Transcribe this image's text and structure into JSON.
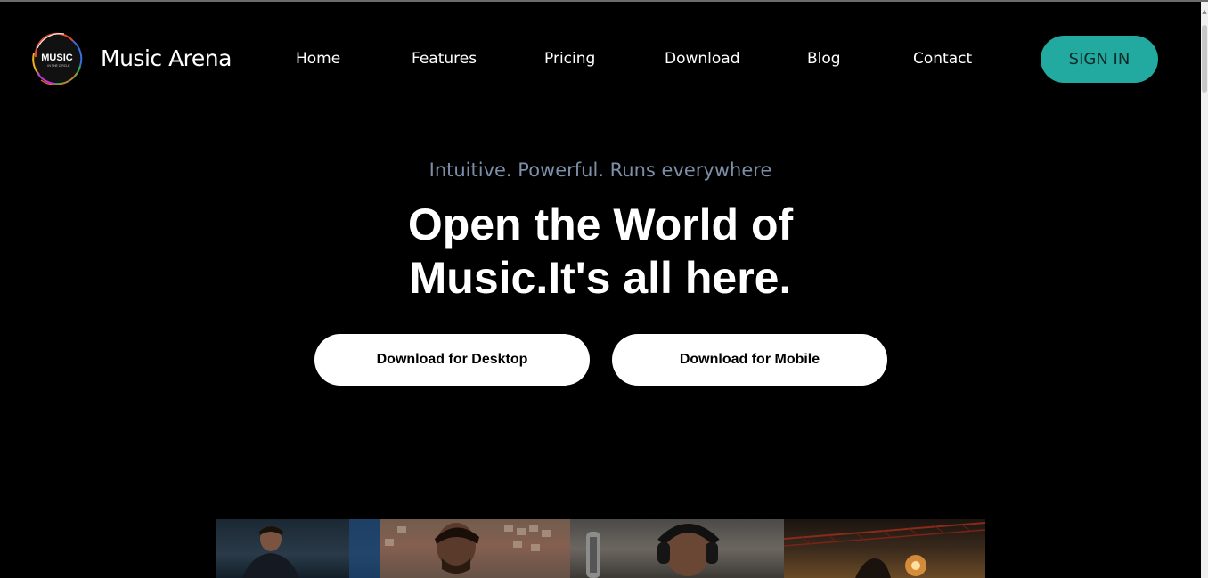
{
  "header": {
    "logo_text": "MUSIC",
    "logo_subtext": "IN THE CIRCLE",
    "brand": "Music Arena",
    "nav": [
      {
        "label": "Home"
      },
      {
        "label": "Features"
      },
      {
        "label": "Pricing"
      },
      {
        "label": "Download"
      },
      {
        "label": "Blog"
      },
      {
        "label": "Contact"
      }
    ],
    "signin_label": "SIGN IN"
  },
  "hero": {
    "tagline": "Intuitive. Powerful. Runs everywhere",
    "headline_line1": "Open the World of",
    "headline_line2": "Music.It's all here.",
    "download_desktop_label": "Download for Desktop",
    "download_mobile_label": "Download for Mobile"
  },
  "gallery": {
    "images": [
      {
        "name": "artist-photo-1"
      },
      {
        "name": "artist-photo-2"
      },
      {
        "name": "artist-photo-3"
      },
      {
        "name": "artist-photo-4"
      }
    ]
  },
  "colors": {
    "background": "#000000",
    "accent": "#22a9a0",
    "tagline": "#7d8fa8",
    "button_bg": "#ffffff"
  },
  "icons": {
    "logo": "music-circle-logo",
    "scroll_up": "triangle-up"
  }
}
